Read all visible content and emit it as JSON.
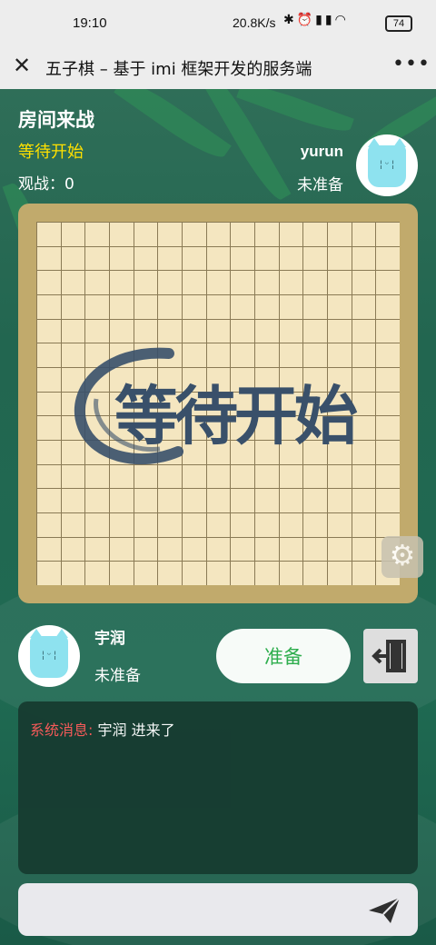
{
  "status_bar": {
    "time": "19:10",
    "network": "20.8K/s",
    "battery": "74",
    "icons": [
      "bluetooth-icon",
      "alarm-icon",
      "signal-hd-icon",
      "signal-icon",
      "wifi-icon",
      "battery-icon"
    ]
  },
  "title_bar": {
    "title": "五子棋 – 基于 imi 框架开发的服务端"
  },
  "room": {
    "title": "房间来战",
    "status": "等待开始",
    "watchers_label": "观战：0"
  },
  "opponent": {
    "name": "yurun",
    "ready_status": "未准备"
  },
  "board": {
    "size": 15,
    "overlay_text": "等待开始"
  },
  "me": {
    "name": "宇润",
    "ready_status": "未准备"
  },
  "actions": {
    "ready_label": "准备"
  },
  "chat": {
    "messages": [
      {
        "prefix": "系统消息:",
        "text": " 宇润 进来了"
      }
    ]
  },
  "input": {
    "placeholder": ""
  },
  "colors": {
    "background": "#226650",
    "status_yellow": "#ffe000",
    "system_red": "#ff5a5a",
    "ready_green": "#2fae4e",
    "board": "#f4e6c0",
    "board_frame": "#c1aa6c"
  }
}
